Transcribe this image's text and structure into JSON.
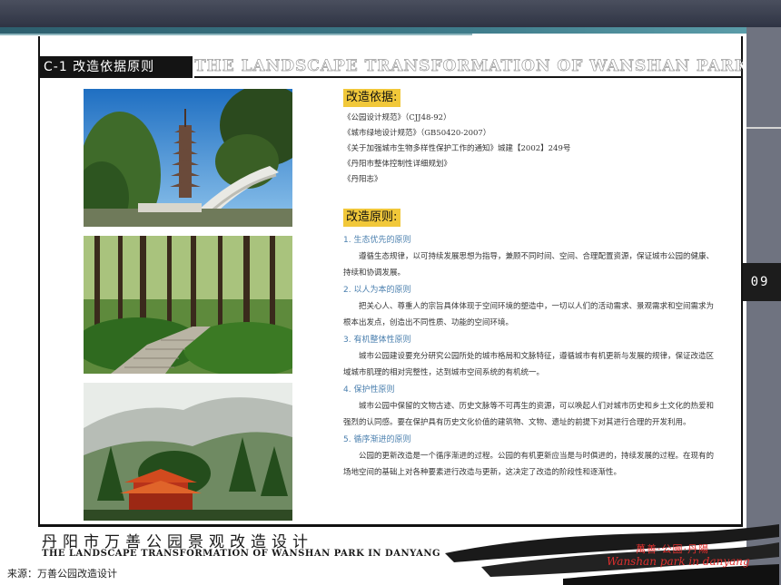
{
  "header": {
    "section_label": "C-1 改造依据原则",
    "english_banner": "THE LANDSCAPE TRANSFORMATION OF WANSHAN PARK IN DANYANG"
  },
  "page_number": "09",
  "basis": {
    "heading": "改造依据:",
    "items": [
      "《公园设计规范》（CJJ48-92）",
      "《城市绿地设计规范》（GB50420-2007）",
      "《关于加强城市生物多样性保护工作的通知》城建【2002】249号",
      "《丹阳市整体控制性详细规划》",
      "《丹阳志》"
    ]
  },
  "principles": {
    "heading": "改造原则:",
    "items": [
      {
        "title": "1. 生态优先的原则",
        "body": "遵循生态规律，以可持续发展思想为指导，兼顾不同时间、空间、合理配置资源，保证城市公园的健康、持续和协调发展。"
      },
      {
        "title": "2. 以人为本的原则",
        "body": "把关心人、尊重人的宗旨具体体现于空间环境的塑造中，一切以人们的活动需求、景观需求和空间需求为根本出发点，创造出不同性质、功能的空间环境。"
      },
      {
        "title": "3. 有机整体性原则",
        "body": "城市公园建设要充分研究公园所处的城市格局和文脉特征，遵循城市有机更新与发展的规律，保证改造区域城市肌理的相对完整性，达到城市空间系统的有机统一。"
      },
      {
        "title": "4. 保护性原则",
        "body": "城市公园中保留的文物古迹、历史文脉等不可再生的资源，可以唤起人们对城市历史和乡土文化的热爱和强烈的认同感。要在保护具有历史文化价值的建筑物、文物、遗址的前提下对其进行合理的开发利用。"
      },
      {
        "title": "5. 循序渐进的原则",
        "body": "公园的更新改造是一个循序渐进的过程。公园的有机更新应当是与时俱进的，持续发展的过程。在现有的场地空间的基础上对各种要素进行改造与更新，这决定了改造的阶段性和逐渐性。"
      }
    ]
  },
  "footer": {
    "title_cn": "丹阳市万善公园景观改造设计",
    "title_en": "THE LANDSCAPE TRANSFORMATION OF WANSHAN PARK IN DANYANG",
    "brand_cn": "萬善·公園·丹陽",
    "brand_en": "Wanshan park in danyang"
  },
  "source_note": "来源：万善公园改造设计",
  "colors": {
    "accent_yellow": "#f1c83a",
    "principle_blue": "#4a7fae",
    "brand_red": "#e0302e"
  }
}
